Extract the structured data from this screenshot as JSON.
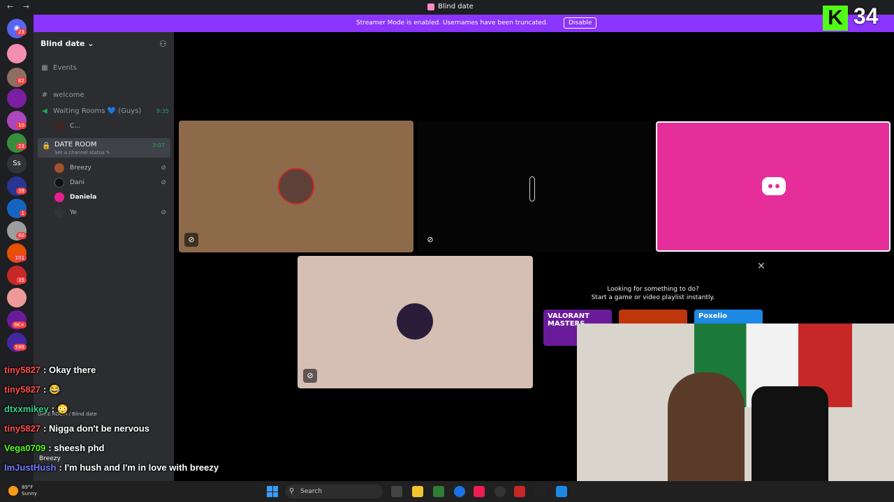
{
  "titlebar": {
    "title": "Blind date",
    "back": "←",
    "forward": "→"
  },
  "banner": {
    "text": "Streamer Mode is enabled. Usernames have been truncated.",
    "button": "Disable"
  },
  "kick": {
    "logo": "K",
    "count": "34"
  },
  "rail_badges": [
    "23",
    "82",
    "10",
    "23",
    "39",
    "1",
    "60",
    "151",
    "35",
    "8K+",
    "588"
  ],
  "rail_text_server": "Ss",
  "sidebar": {
    "server_name": "Blind date ⌄",
    "events": "Events",
    "channels": [
      {
        "name": "welcome",
        "icon": "#"
      },
      {
        "name": "Waiting Rooms 💙 (Guys)",
        "time": "9:35"
      }
    ],
    "waiting_member": "C...",
    "date_room": {
      "name": "DATE ROOM",
      "status": "Set a channel status ✎",
      "time": "3:07"
    },
    "members": [
      {
        "name": "Breezy",
        "color": "#a0522d"
      },
      {
        "name": "Dani",
        "color": "#222"
      },
      {
        "name": "Daniela",
        "color": "#e91e8c"
      },
      {
        "name": "Ye",
        "color": "#555"
      }
    ]
  },
  "activity": {
    "line1": "Looking for something to do?",
    "line2": "Start a game or video playlist instantly.",
    "cards": [
      "VALORANT MASTERS",
      "",
      "Poxelio"
    ]
  },
  "chat": [
    {
      "user": "tiny5827",
      "msg": ": Okay there",
      "color": "#ff4b4b"
    },
    {
      "user": "tiny5827",
      "msg": ": 😂",
      "color": "#ff4b4b"
    },
    {
      "user": "dtxxmikey",
      "msg": ": 😳",
      "color": "#2ed18b"
    },
    {
      "user": "tiny5827",
      "msg": ": Nigga don't be nervous",
      "color": "#ff4b4b"
    },
    {
      "user": "Vega0709",
      "msg": ": sheesh phd",
      "color": "#53fc18"
    },
    {
      "user": "ImJustHush",
      "msg": ": I'm hush and I'm in love with breezy",
      "color": "#6e7bff"
    }
  ],
  "voice_panel": {
    "room": "DATE ROOM / Blind date",
    "user": "Breezy"
  },
  "taskbar": {
    "temp": "89°F",
    "cond": "Sunny",
    "search": "Search"
  },
  "colors": {
    "banner": "#8b35ff",
    "brand_pink": "#e62e9a",
    "kick_green": "#53fc18"
  }
}
